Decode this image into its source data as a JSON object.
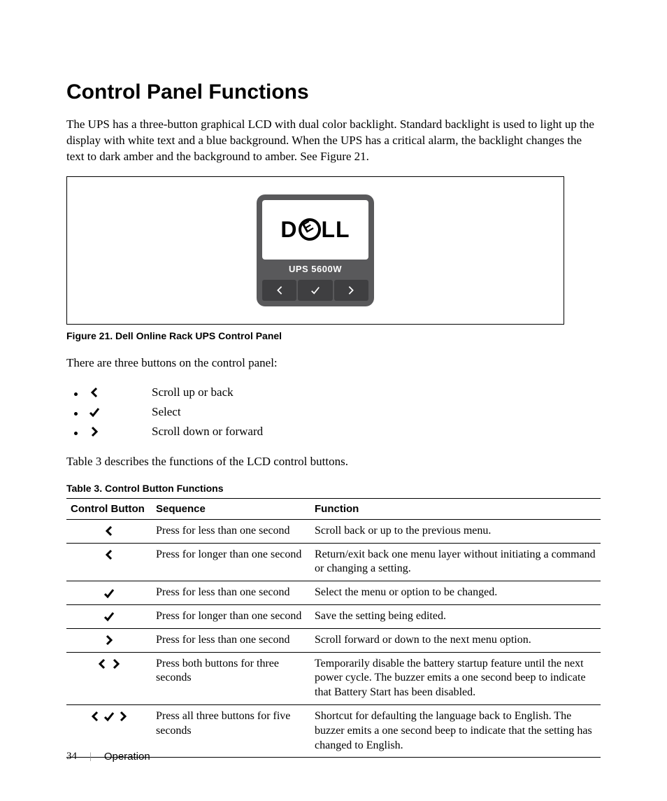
{
  "heading": "Control Panel Functions",
  "intro": "The UPS has a three-button graphical LCD with dual color backlight. Standard backlight is used to light up the display with white text and a blue background. When the UPS has a critical alarm, the backlight changes the text to dark amber and the background to amber. See Figure 21.",
  "figure": {
    "model": "UPS 5600W",
    "caption": "Figure 21. Dell Online Rack UPS Control Panel"
  },
  "buttons_intro": "There are three buttons on the control panel:",
  "button_list": [
    {
      "icon": "left",
      "label": "Scroll up or back"
    },
    {
      "icon": "check",
      "label": "Select"
    },
    {
      "icon": "right",
      "label": "Scroll down or forward"
    }
  ],
  "table_intro": "Table 3 describes the functions of the LCD control buttons.",
  "table": {
    "caption": "Table 3. Control Button Functions",
    "headers": {
      "c1": "Control Button",
      "c2": "Sequence",
      "c3": "Function"
    },
    "rows": [
      {
        "icons": [
          "left"
        ],
        "sequence": "Press for less than one second",
        "function": "Scroll back or up to the previous menu."
      },
      {
        "icons": [
          "left"
        ],
        "sequence": "Press for longer than one second",
        "function": "Return/exit back one menu layer without initiating a command or changing a setting."
      },
      {
        "icons": [
          "check"
        ],
        "sequence": "Press for less than one second",
        "function": "Select the menu or option to be changed."
      },
      {
        "icons": [
          "check"
        ],
        "sequence": "Press for longer than one second",
        "function": "Save the setting being edited."
      },
      {
        "icons": [
          "right"
        ],
        "sequence": "Press for less than one second",
        "function": "Scroll forward or down to the next menu option."
      },
      {
        "icons": [
          "left",
          "right"
        ],
        "sequence": "Press both buttons for three seconds",
        "function": "Temporarily disable the battery startup feature until the next power cycle. The buzzer emits a one second beep to indicate that Battery Start has been disabled."
      },
      {
        "icons": [
          "left",
          "check",
          "right"
        ],
        "sequence": "Press all three buttons for five seconds",
        "function": "Shortcut for defaulting the language back to English. The buzzer emits a one second beep to indicate that the setting has changed to English."
      }
    ]
  },
  "footer": {
    "page": "34",
    "section": "Operation"
  }
}
